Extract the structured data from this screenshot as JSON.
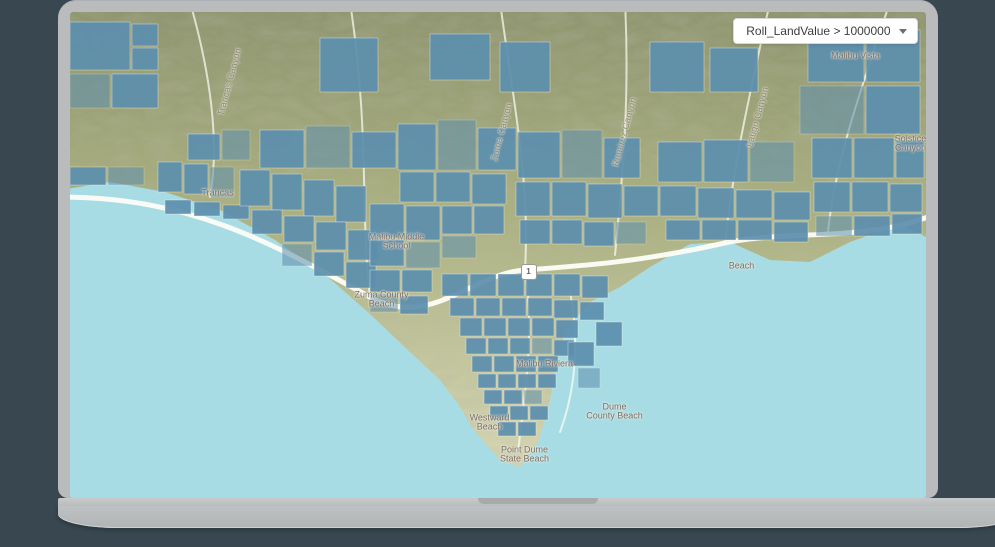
{
  "filter": {
    "expression": "Roll_LandValue > 1000000"
  },
  "highway_badge": "1",
  "labels": {
    "malibu_vista": "Malibu Vista",
    "malibu_middle": "Malibu Middle\nSchool",
    "zuma_county": "Zuma County\nBeach",
    "westward": "Westward\nBeach",
    "point_dume": "Point Dume\nState Beach",
    "dume_county": "Dume\nCounty Beach",
    "beach_east": "Beach",
    "trancas": "Trancas",
    "solstice": "Solstice\nCanyon",
    "trancas_canyon": "Trancas Canyon",
    "zuma_canyon": "Zuma Canyon",
    "ramirez_canyon": "Ramirez Canyon",
    "latigo_canyon": "Latigo Canyon",
    "malibu_riviera": "Malibu Riviera"
  }
}
